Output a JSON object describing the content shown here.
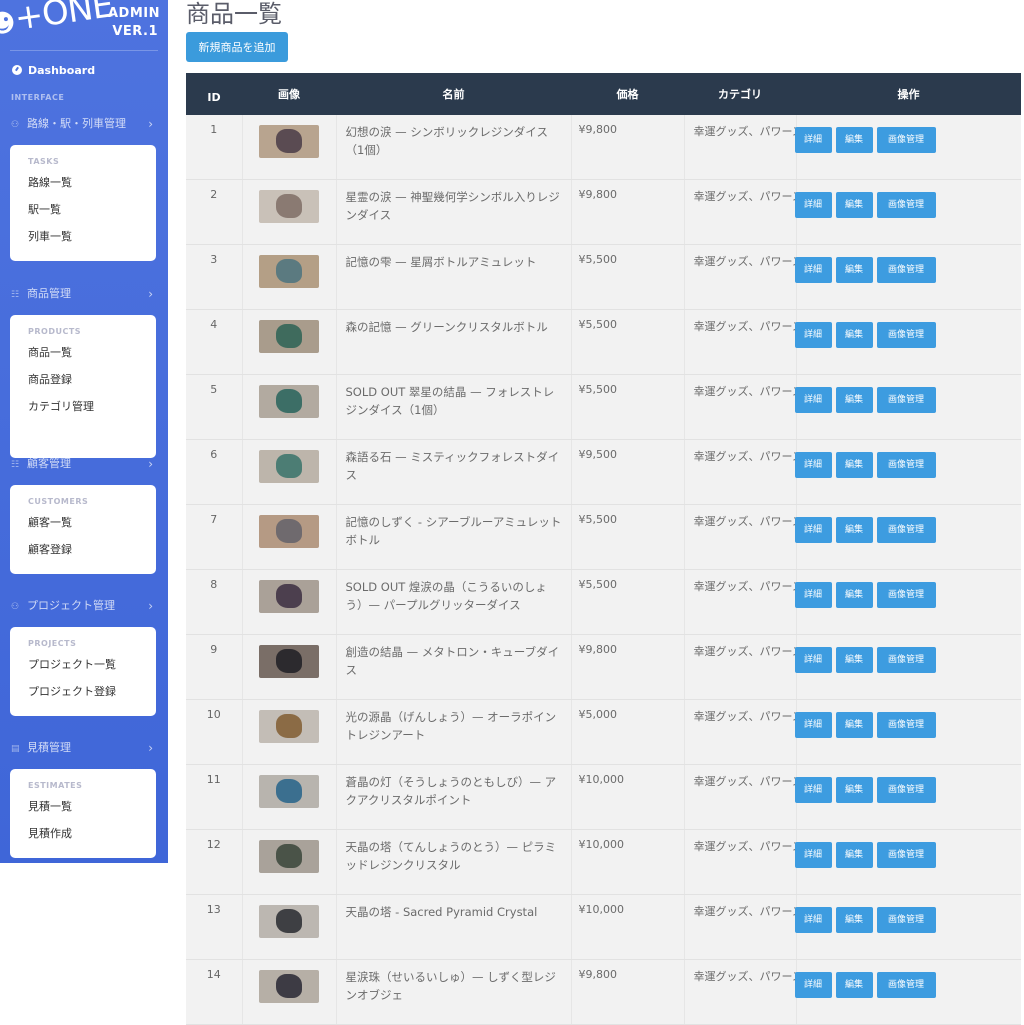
{
  "brand": {
    "logo_text": "+ONE",
    "title_line1": "ADMIN",
    "title_line2": "VER.1"
  },
  "sidebar": {
    "dashboard_label": "Dashboard",
    "interface_heading": "INTERFACE",
    "groups": [
      {
        "label": "路線・駅・列車管理",
        "icon": "network-icon",
        "caption": "TASKS",
        "items": [
          "路線一覧",
          "駅一覧",
          "列車一覧"
        ]
      },
      {
        "label": "商品管理",
        "icon": "users-icon",
        "caption": "PRODUCTS",
        "items": [
          "商品一覧",
          "商品登録",
          "カテゴリ管理"
        ]
      },
      {
        "label": "顧客管理",
        "icon": "users-icon",
        "caption": "CUSTOMERS",
        "items": [
          "顧客一覧",
          "顧客登録"
        ]
      },
      {
        "label": "プロジェクト管理",
        "icon": "network-icon",
        "caption": "PROJECTS",
        "items": [
          "プロジェクト一覧",
          "プロジェクト登録"
        ]
      },
      {
        "label": "見積管理",
        "icon": "document-icon",
        "caption": "ESTIMATES",
        "items": [
          "見積一覧",
          "見積作成"
        ]
      }
    ]
  },
  "main": {
    "title": "商品一覧",
    "add_button": "新規商品を追加",
    "columns": [
      "ID",
      "画像",
      "名前",
      "価格",
      "カテゴリ",
      "操作"
    ],
    "action_labels": {
      "detail": "詳細",
      "edit": "編集",
      "images": "画像管理"
    },
    "rows": [
      {
        "id": "1",
        "name": "幻想の涙 — シンボリックレジンダイス（1個）",
        "price": "¥9,800",
        "category": "幸運グッズ、パワーストーン",
        "thumb": "#b8a48f",
        "obj": "#5a4b52"
      },
      {
        "id": "2",
        "name": "星霊の涙 — 神聖幾何学シンボル入りレジンダイス",
        "price": "¥9,800",
        "category": "幸運グッズ、パワーストーン",
        "thumb": "#c9c1b8",
        "obj": "#8a7a72"
      },
      {
        "id": "3",
        "name": "記憶の雫 — 星屑ボトルアミュレット",
        "price": "¥5,500",
        "category": "幸運グッズ、パワーストーン",
        "thumb": "#b49f86",
        "obj": "#5b7a80"
      },
      {
        "id": "4",
        "name": "森の記憶 — グリーンクリスタルボトル",
        "price": "¥5,500",
        "category": "幸運グッズ、パワーストーン",
        "thumb": "#a99c8c",
        "obj": "#3f6b5d"
      },
      {
        "id": "5",
        "name": "SOLD OUT 翠星の結晶 — フォレストレジンダイス（1個）",
        "price": "¥5,500",
        "category": "幸運グッズ、パワーストーン",
        "thumb": "#b2aaa0",
        "obj": "#3c6e66"
      },
      {
        "id": "6",
        "name": "森語る石 — ミスティックフォレストダイス",
        "price": "¥9,500",
        "category": "幸運グッズ、パワーストーン",
        "thumb": "#bdb5ab",
        "obj": "#4c7d74"
      },
      {
        "id": "7",
        "name": "記憶のしずく - シアーブルーアミュレットボトル",
        "price": "¥5,500",
        "category": "幸運グッズ、パワーストーン",
        "thumb": "#b59a84",
        "obj": "#6f6a6e"
      },
      {
        "id": "8",
        "name": "SOLD OUT 煌涙の晶（こうるいのしょう）— パープルグリッターダイス",
        "price": "¥5,500",
        "category": "幸運グッズ、パワーストーン",
        "thumb": "#aaa198",
        "obj": "#4c3f4e"
      },
      {
        "id": "9",
        "name": "創造の結晶 — メタトロン・キューブダイス",
        "price": "¥9,800",
        "category": "幸運グッズ、パワーストーン",
        "thumb": "#7a6e67",
        "obj": "#2c2a2e"
      },
      {
        "id": "10",
        "name": "光の源晶（げんしょう）— オーラポイントレジンアート",
        "price": "¥5,000",
        "category": "幸運グッズ、パワーストーン",
        "thumb": "#c3bdb6",
        "obj": "#8b6b45"
      },
      {
        "id": "11",
        "name": "蒼晶の灯（そうしょうのともしび）— アクアクリスタルポイント",
        "price": "¥10,000",
        "category": "幸運グッズ、パワーストーン",
        "thumb": "#b8b4ae",
        "obj": "#3b6f8f"
      },
      {
        "id": "12",
        "name": "天晶の塔（てんしょうのとう）— ピラミッドレジンクリスタル",
        "price": "¥10,000",
        "category": "幸運グッズ、パワーストーン",
        "thumb": "#a9a29a",
        "obj": "#4a5348"
      },
      {
        "id": "13",
        "name": "天晶の塔 - Sacred Pyramid Crystal",
        "price": "¥10,000",
        "category": "幸運グッズ、パワーストーン",
        "thumb": "#bcb7b1",
        "obj": "#3e3f43"
      },
      {
        "id": "14",
        "name": "星涙珠（せいるいしゅ）— しずく型レジンオブジェ",
        "price": "¥9,800",
        "category": "幸運グッズ、パワーストーン",
        "thumb": "#b6afa6",
        "obj": "#3d3b44"
      }
    ]
  },
  "colors": {
    "sidebar": "#4e73df",
    "header": "#2b3a4d",
    "button": "#3b9bdc",
    "row_bg": "#f2f2f2"
  }
}
